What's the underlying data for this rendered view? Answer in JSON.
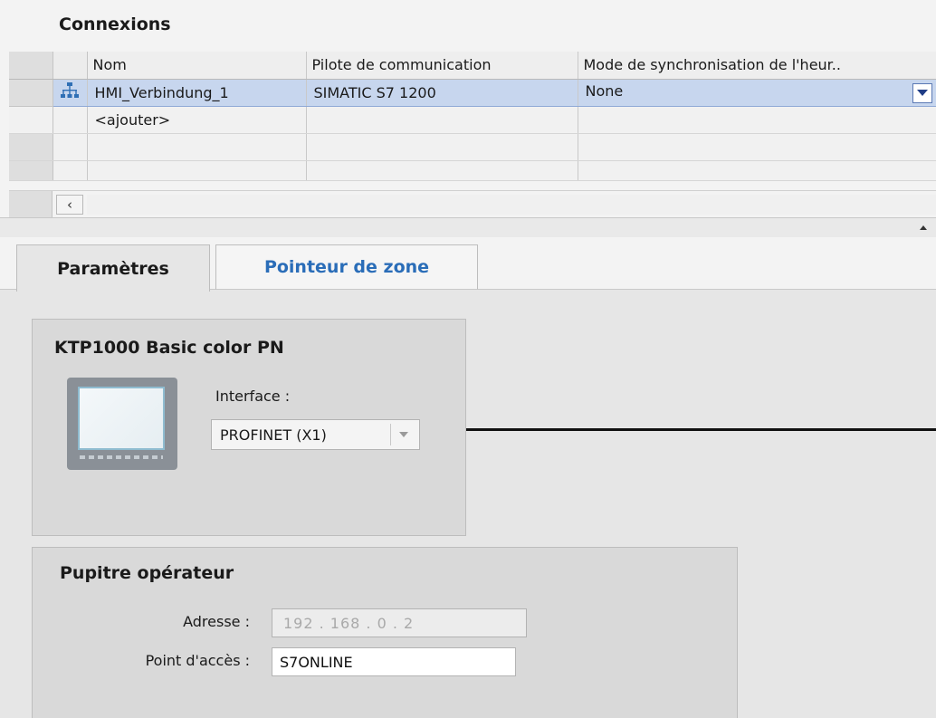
{
  "connections": {
    "title": "Connexions",
    "columns": [
      "Nom",
      "Pilote de communication",
      "Mode de synchronisation de l'heur.."
    ],
    "rows": [
      {
        "name": "HMI_Verbindung_1",
        "driver": "SIMATIC S7 1200",
        "sync_mode": "None"
      }
    ],
    "add_row_label": "<ajouter>"
  },
  "tabs": [
    {
      "label": "Paramètres",
      "active": true
    },
    {
      "label": "Pointeur de zone",
      "active": false
    }
  ],
  "hmi_device": {
    "title": "KTP1000 Basic color PN",
    "interface_label": "Interface :",
    "interface_value": "PROFINET (X1)"
  },
  "operator_panel": {
    "title": "Pupitre opérateur",
    "address_label": "Adresse :",
    "address_value": "192 . 168 . 0    . 2",
    "access_point_label": "Point d'accès :",
    "access_point_value": "S7ONLINE"
  },
  "icons": {
    "connection": "network-connection-icon",
    "dropdown": "chevron-down-icon",
    "scroll_left": "scroll-left-arrow-icon",
    "collapse": "collapse-up-icon"
  },
  "colors": {
    "selected_row": "#c7d6ee",
    "inactive_tab_text": "#2a6db8",
    "dropdown_arrow": "#1f3d86"
  }
}
